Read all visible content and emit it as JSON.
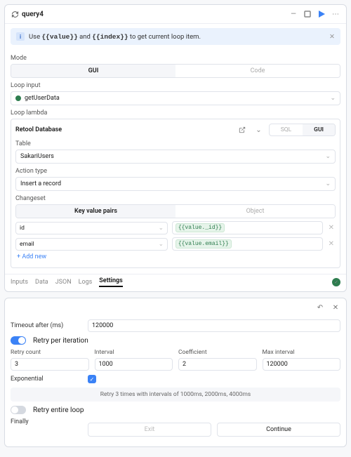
{
  "header": {
    "icon": "cycle-icon",
    "title": "query4"
  },
  "banner": {
    "prefix": "Use ",
    "code1": "{{value}}",
    "mid": " and ",
    "code2": "{{index}}",
    "suffix": " to get current loop item."
  },
  "mode": {
    "label": "Mode",
    "gui": "GUI",
    "code": "Code"
  },
  "loopInput": {
    "label": "Loop input",
    "value": "getUserData"
  },
  "lambda": {
    "label": "Loop lambda",
    "resource": "Retool Database",
    "sql": "SQL",
    "gui": "GUI",
    "tableLabel": "Table",
    "table": "SakariUsers",
    "actionLabel": "Action type",
    "action": "Insert a record",
    "changesetLabel": "Changeset",
    "kv": "Key value pairs",
    "obj": "Object",
    "rows": [
      {
        "key": "id",
        "val": "{{value._id}}"
      },
      {
        "key": "email",
        "val": "{{value.email}}"
      }
    ],
    "addNew": "+ Add new"
  },
  "bottomTabs": [
    "Inputs",
    "Data",
    "JSON",
    "Logs",
    "Settings"
  ],
  "settings": {
    "timeoutLabel": "Timeout after (ms)",
    "timeout": "120000",
    "retryPerIter": "Retry per iteration",
    "retryCountLabel": "Retry count",
    "retryCount": "3",
    "intervalLabel": "Interval",
    "interval": "1000",
    "coeffLabel": "Coefficient",
    "coeff": "2",
    "maxIntervalLabel": "Max interval",
    "maxInterval": "120000",
    "exponentialLabel": "Exponential",
    "note": "Retry 3 times with intervals of 1000ms, 2000ms, 4000ms",
    "retryEntire": "Retry entire loop",
    "finallyLabel": "Finally",
    "exit": "Exit",
    "continue": "Continue"
  }
}
